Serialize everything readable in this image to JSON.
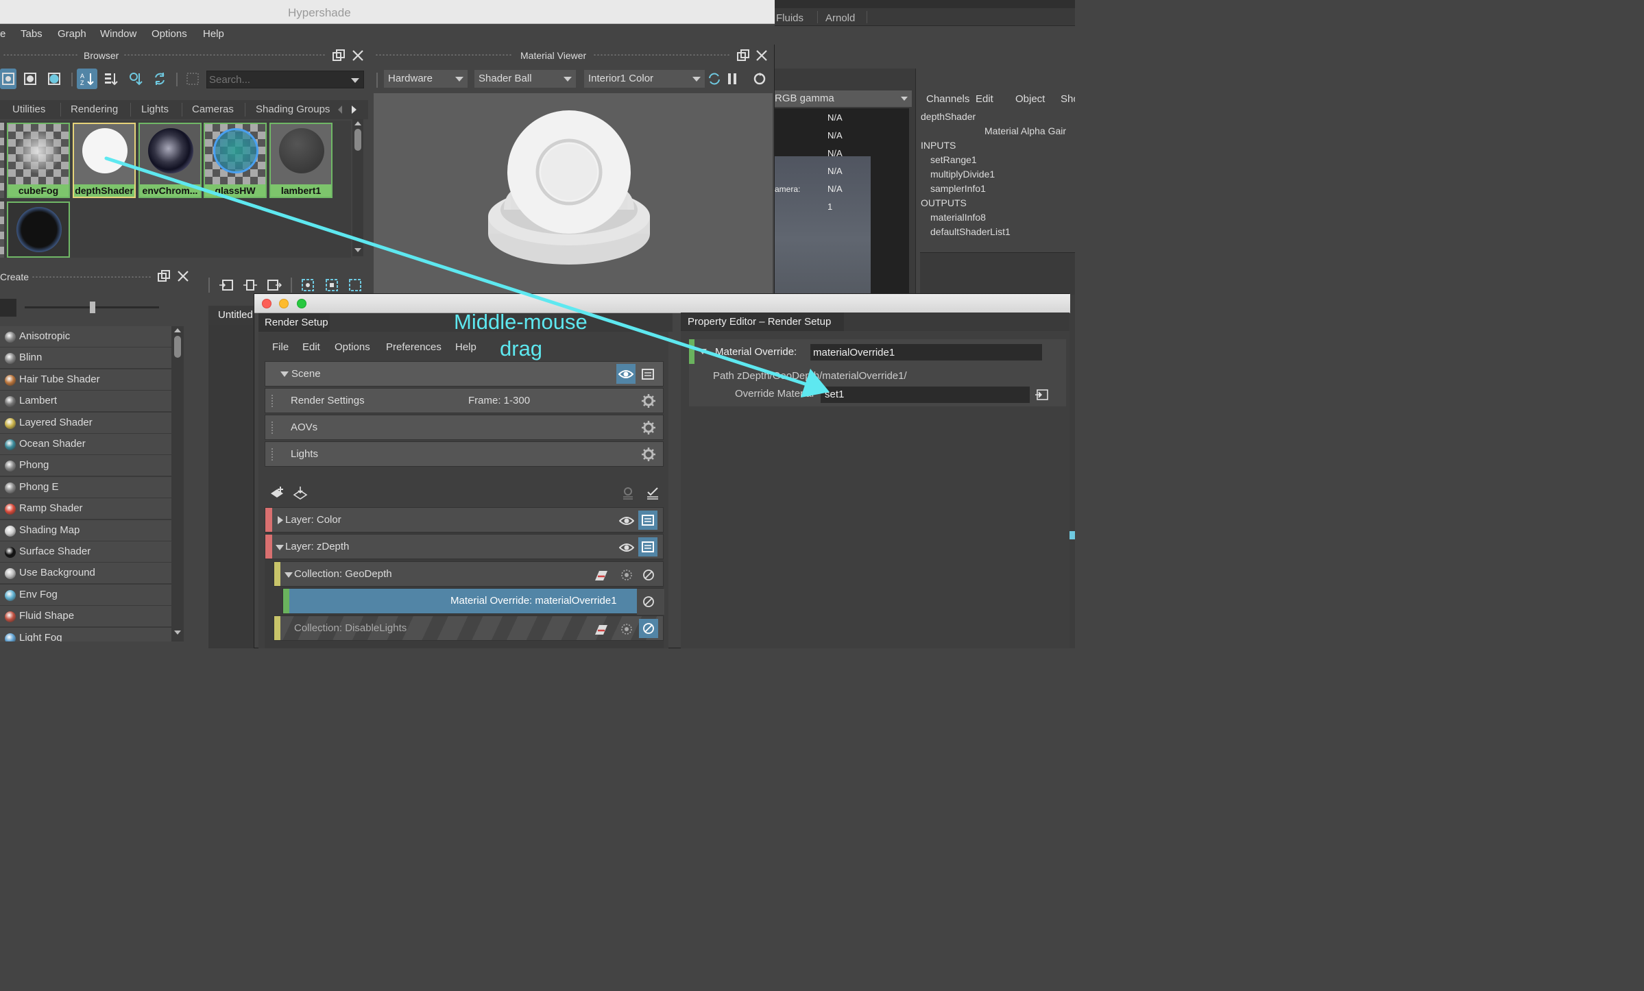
{
  "hypershade": {
    "title": "Hypershade",
    "menu": [
      "e",
      "Tabs",
      "Graph",
      "Window",
      "Options",
      "Help"
    ]
  },
  "browser": {
    "title": "Browser",
    "search_placeholder": "Search...",
    "tabs": [
      "Utilities",
      "Rendering",
      "Lights",
      "Cameras",
      "Shading Groups"
    ],
    "swatches": [
      {
        "label": "cubeFog"
      },
      {
        "label": "depthShader"
      },
      {
        "label": "envChrom..."
      },
      {
        "label": "glassHW"
      },
      {
        "label": "lambert1"
      }
    ]
  },
  "material_viewer": {
    "title": "Material Viewer",
    "renderer": "Hardware",
    "geometry": "Shader Ball",
    "environment": "Interior1 Color"
  },
  "create_panel": {
    "title": "Create",
    "items": [
      {
        "name": "Anisotropic",
        "color": "#888"
      },
      {
        "name": "Blinn",
        "color": "#888"
      },
      {
        "name": "Hair Tube Shader",
        "color": "#b8733a"
      },
      {
        "name": "Lambert",
        "color": "#777"
      },
      {
        "name": "Layered Shader",
        "color": "#c9b24a"
      },
      {
        "name": "Ocean Shader",
        "color": "#3a8a9a"
      },
      {
        "name": "Phong",
        "color": "#888"
      },
      {
        "name": "Phong E",
        "color": "#888"
      },
      {
        "name": "Ramp Shader",
        "color": "#d94a3a"
      },
      {
        "name": "Shading Map",
        "color": "#cfcfcf"
      },
      {
        "name": "Surface Shader",
        "color": "#111111"
      },
      {
        "name": "Use Background",
        "color": "#bbb"
      },
      {
        "name": "Env Fog",
        "color": "#5fb0d0"
      },
      {
        "name": "Fluid Shape",
        "color": "#c05040"
      },
      {
        "name": "Light Fog",
        "color": "#5fa0d0"
      }
    ]
  },
  "untitled_tab": "Untitled",
  "right_bg": {
    "tabs": [
      "Fluids",
      "Arnold"
    ],
    "gamma": "RGB gamma",
    "values": [
      "N/A",
      "N/A",
      "N/A",
      "N/A",
      "N/A",
      "1"
    ],
    "camera_label": "amera:"
  },
  "channel_box": {
    "menu": [
      "Channels",
      "Edit",
      "Object",
      "Sho"
    ],
    "node": "depthShader",
    "attr": "Material Alpha Gair",
    "inputs_label": "INPUTS",
    "inputs": [
      "setRange1",
      "multiplyDivide1",
      "samplerInfo1"
    ],
    "outputs_label": "OUTPUTS",
    "outputs": [
      "materialInfo8",
      "defaultShaderList1"
    ]
  },
  "render_setup": {
    "tab": "Render Setup",
    "menu": [
      "File",
      "Edit",
      "Options",
      "Preferences",
      "Help"
    ],
    "scene": "Scene",
    "render_settings": "Render Settings",
    "frame": "Frame: 1-300",
    "aovs": "AOVs",
    "lights": "Lights",
    "layer_color": "Layer:   Color",
    "layer_zdepth": "Layer:   zDepth",
    "collection_geo": "Collection:   GeoDepth",
    "material_override": "Material Override:   materialOverride1",
    "collection_disable": "Collection:   DisableLights"
  },
  "annotation": {
    "line1": "Middle-mouse",
    "line2": "drag"
  },
  "property_editor": {
    "tab": "Property Editor – Render Setup",
    "override_label": "Material Override:",
    "override_value": "materialOverride1",
    "path": "Path  zDepth/GeoDepth/materialOverride1/",
    "override_material_label": "Override Material",
    "override_material_value": "set1"
  },
  "colors": {
    "swatch_green": "#7dc56c",
    "selection_blue": "#5285a6",
    "arrow_cyan": "#5ee8f0",
    "layer_red": "#d97070",
    "collection_yellow": "#c8c46a",
    "override_green": "#6ab35e"
  }
}
